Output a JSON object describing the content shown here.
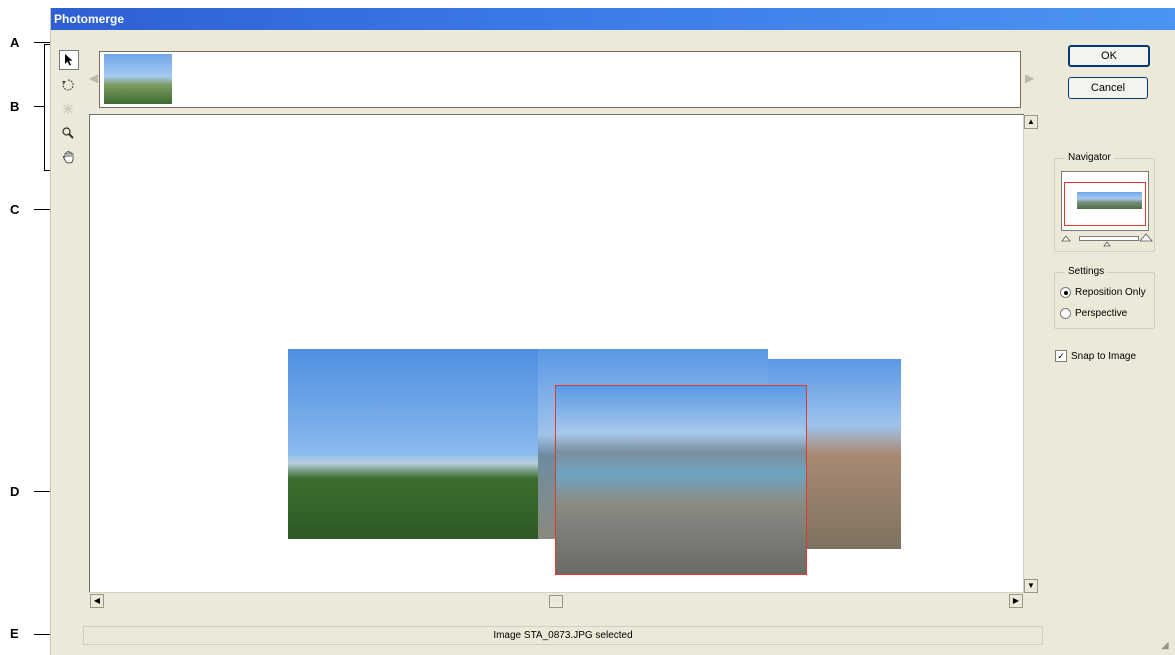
{
  "window": {
    "title": "Photomerge"
  },
  "callouts": [
    "A",
    "B",
    "C",
    "D",
    "E"
  ],
  "buttons": {
    "ok": "OK",
    "cancel": "Cancel"
  },
  "navigator": {
    "title": "Navigator"
  },
  "settings": {
    "title": "Settings",
    "options": [
      {
        "label": "Reposition Only",
        "selected": true
      },
      {
        "label": "Perspective",
        "selected": false
      }
    ]
  },
  "snap": {
    "label": "Snap to Image",
    "checked": true
  },
  "status": {
    "text": "Image STA_0873.JPG selected"
  },
  "icons": {
    "tools": [
      "select-image-icon",
      "rotate-image-icon",
      "vanishing-point-icon",
      "zoom-icon",
      "hand-icon"
    ]
  },
  "colors": {
    "titlebar": "#3b7be7",
    "selection": "#e03a2e",
    "dialog": "#ece9d8"
  }
}
